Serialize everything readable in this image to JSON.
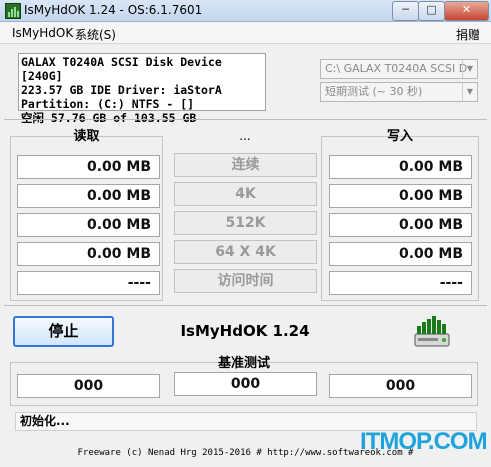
{
  "window": {
    "title": "IsMyHdOK 1.24 - OS:6.1.7601",
    "minimize": "─",
    "maximize": "□",
    "close": "✕"
  },
  "menu": {
    "app": "IsMyHdOK",
    "system": "系统(S)",
    "donate": "捐赠"
  },
  "disk": {
    "line1": "GALAX T0240A SCSI Disk Device [240G]",
    "line2": "223.57 GB  IDE Driver: iaStorA",
    "line3": "Partition: (C:) NTFS - []",
    "line4": "空闲 57.76 GB of 103.55 GB"
  },
  "drive_select": {
    "value": "C:\\  GALAX T0240A SCSI D"
  },
  "test_select": {
    "value": "短期测试 (~ 30 秒)"
  },
  "read": {
    "header": "读取",
    "values": [
      "0.00 MB",
      "0.00 MB",
      "0.00 MB",
      "0.00 MB",
      "----"
    ]
  },
  "middle": {
    "header": "...",
    "buttons": [
      "连续",
      "4K",
      "512K",
      "64 X 4K",
      "访问时间"
    ]
  },
  "write": {
    "header": "写入",
    "values": [
      "0.00 MB",
      "0.00 MB",
      "0.00 MB",
      "0.00 MB",
      "----"
    ]
  },
  "controls": {
    "stop": "停止",
    "app_name": "IsMyHdOK 1.24"
  },
  "benchmark": {
    "header": "基准测试",
    "values": [
      "000",
      "000",
      "000"
    ]
  },
  "status": "初始化...",
  "footer": "Freeware (c) Nenad Hrg 2015-2016 # http://www.softwareok.com #",
  "watermark": "ITMOP.COM",
  "colors": {
    "accent": "#3377d6",
    "title_bar": "#c3d6ee",
    "watermark": "#1fa3dc"
  }
}
